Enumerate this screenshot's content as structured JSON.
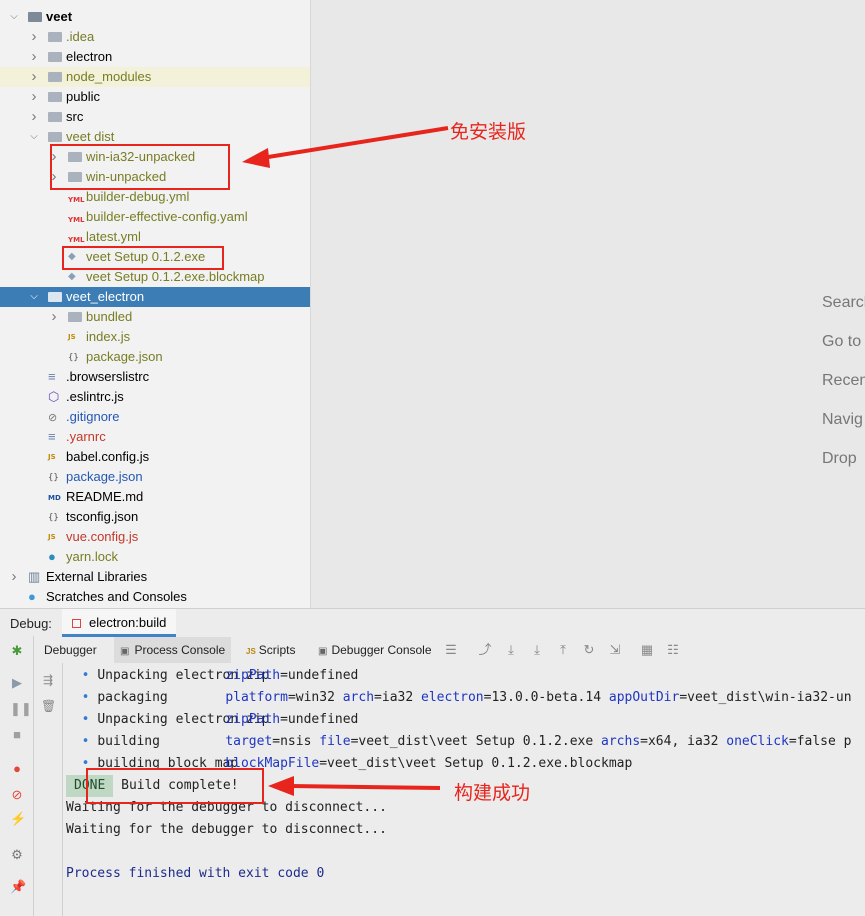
{
  "tree": [
    {
      "label": "veet",
      "depth": 0,
      "arrow": "open",
      "icon": "folder-dark",
      "color": "bold"
    },
    {
      "label": ".idea",
      "depth": 1,
      "arrow": "closed",
      "icon": "folder",
      "color": "olive"
    },
    {
      "label": "electron",
      "depth": 1,
      "arrow": "closed",
      "icon": "folder",
      "color": "normal"
    },
    {
      "label": "node_modules",
      "depth": 1,
      "arrow": "closed",
      "icon": "folder",
      "color": "olive",
      "highlight": true
    },
    {
      "label": "public",
      "depth": 1,
      "arrow": "closed",
      "icon": "folder",
      "color": "normal"
    },
    {
      "label": "src",
      "depth": 1,
      "arrow": "closed",
      "icon": "folder",
      "color": "normal"
    },
    {
      "label": "veet dist",
      "depth": 1,
      "arrow": "open",
      "icon": "folder",
      "color": "olive"
    },
    {
      "label": "win-ia32-unpacked",
      "depth": 2,
      "arrow": "closed",
      "icon": "folder",
      "color": "olive"
    },
    {
      "label": "win-unpacked",
      "depth": 2,
      "arrow": "closed",
      "icon": "folder",
      "color": "olive"
    },
    {
      "label": "builder-debug.yml",
      "depth": 2,
      "arrow": "",
      "icon": "yml",
      "color": "olive"
    },
    {
      "label": "builder-effective-config.yaml",
      "depth": 2,
      "arrow": "",
      "icon": "yml",
      "color": "olive"
    },
    {
      "label": "latest.yml",
      "depth": 2,
      "arrow": "",
      "icon": "yml",
      "color": "olive"
    },
    {
      "label": "veet Setup 0.1.2.exe",
      "depth": 2,
      "arrow": "",
      "icon": "file",
      "color": "olive"
    },
    {
      "label": "veet Setup 0.1.2.exe.blockmap",
      "depth": 2,
      "arrow": "",
      "icon": "file",
      "color": "olive"
    },
    {
      "label": "veet_electron",
      "depth": 1,
      "arrow": "open",
      "icon": "folder",
      "color": "normal",
      "selected": true
    },
    {
      "label": "bundled",
      "depth": 2,
      "arrow": "closed",
      "icon": "folder",
      "color": "olive"
    },
    {
      "label": "index.js",
      "depth": 2,
      "arrow": "",
      "icon": "js",
      "color": "olive"
    },
    {
      "label": "package.json",
      "depth": 2,
      "arrow": "",
      "icon": "json",
      "color": "olive"
    },
    {
      "label": ".browserslistrc",
      "depth": 1,
      "arrow": "",
      "icon": "lines",
      "color": "normal"
    },
    {
      "label": ".eslintrc.js",
      "depth": 1,
      "arrow": "",
      "icon": "eslint",
      "color": "normal"
    },
    {
      "label": ".gitignore",
      "depth": 1,
      "arrow": "",
      "icon": "ignore",
      "color": "blue"
    },
    {
      "label": ".yarnrc",
      "depth": 1,
      "arrow": "",
      "icon": "lines",
      "color": "red"
    },
    {
      "label": "babel.config.js",
      "depth": 1,
      "arrow": "",
      "icon": "js",
      "color": "normal"
    },
    {
      "label": "package.json",
      "depth": 1,
      "arrow": "",
      "icon": "json",
      "color": "blue"
    },
    {
      "label": "README.md",
      "depth": 1,
      "arrow": "",
      "icon": "md",
      "color": "normal"
    },
    {
      "label": "tsconfig.json",
      "depth": 1,
      "arrow": "",
      "icon": "json",
      "color": "normal"
    },
    {
      "label": "vue.config.js",
      "depth": 1,
      "arrow": "",
      "icon": "js",
      "color": "red"
    },
    {
      "label": "yarn.lock",
      "depth": 1,
      "arrow": "",
      "icon": "yarn",
      "color": "olive"
    },
    {
      "label": "External Libraries",
      "depth": 0,
      "arrow": "closed",
      "icon": "libs",
      "color": "normal"
    },
    {
      "label": "Scratches and Consoles",
      "depth": 0,
      "arrow": "",
      "icon": "scratch",
      "color": "normal"
    }
  ],
  "editor_hints": [
    "Search",
    "Go to",
    "Recen",
    "Navig",
    "Drop"
  ],
  "annotations": {
    "portable": "免安装版",
    "build_success": "构建成功"
  },
  "debug": {
    "label": "Debug:",
    "tab": "electron:build",
    "subtabs": [
      "Debugger",
      "Process Console",
      "Scripts",
      "Debugger Console"
    ]
  },
  "console": [
    {
      "bullet": "•",
      "name": "Unpacking electron zip",
      "parts": [
        [
          "kw",
          "zipPath"
        ],
        [
          "t",
          "=undefined"
        ]
      ]
    },
    {
      "bullet": "•",
      "name": "packaging",
      "parts": [
        [
          "kw",
          "platform"
        ],
        [
          "t",
          "=win32 "
        ],
        [
          "kw",
          "arch"
        ],
        [
          "t",
          "=ia32 "
        ],
        [
          "kw",
          "electron"
        ],
        [
          "t",
          "=13.0.0-beta.14 "
        ],
        [
          "kw",
          "appOutDir"
        ],
        [
          "t",
          "=veet_dist\\win-ia32-un"
        ]
      ]
    },
    {
      "bullet": "•",
      "name": "Unpacking electron zip",
      "parts": [
        [
          "kw",
          "zipPath"
        ],
        [
          "t",
          "=undefined"
        ]
      ]
    },
    {
      "bullet": "•",
      "name": "building",
      "parts": [
        [
          "kw",
          "target"
        ],
        [
          "t",
          "=nsis "
        ],
        [
          "kw",
          "file"
        ],
        [
          "t",
          "=veet_dist\\veet Setup 0.1.2.exe "
        ],
        [
          "kw",
          "archs"
        ],
        [
          "t",
          "=x64, ia32 "
        ],
        [
          "kw",
          "oneClick"
        ],
        [
          "t",
          "=false p"
        ]
      ]
    },
    {
      "bullet": "•",
      "name": "building block map",
      "parts": [
        [
          "kw",
          "blockMapFile"
        ],
        [
          "t",
          "=veet_dist\\veet Setup 0.1.2.exe.blockmap"
        ]
      ]
    }
  ],
  "done_badge": "DONE",
  "build_complete": "Build complete!",
  "waiting": "Waiting for the debugger to disconnect...",
  "exit_line": "Process finished with exit code 0"
}
